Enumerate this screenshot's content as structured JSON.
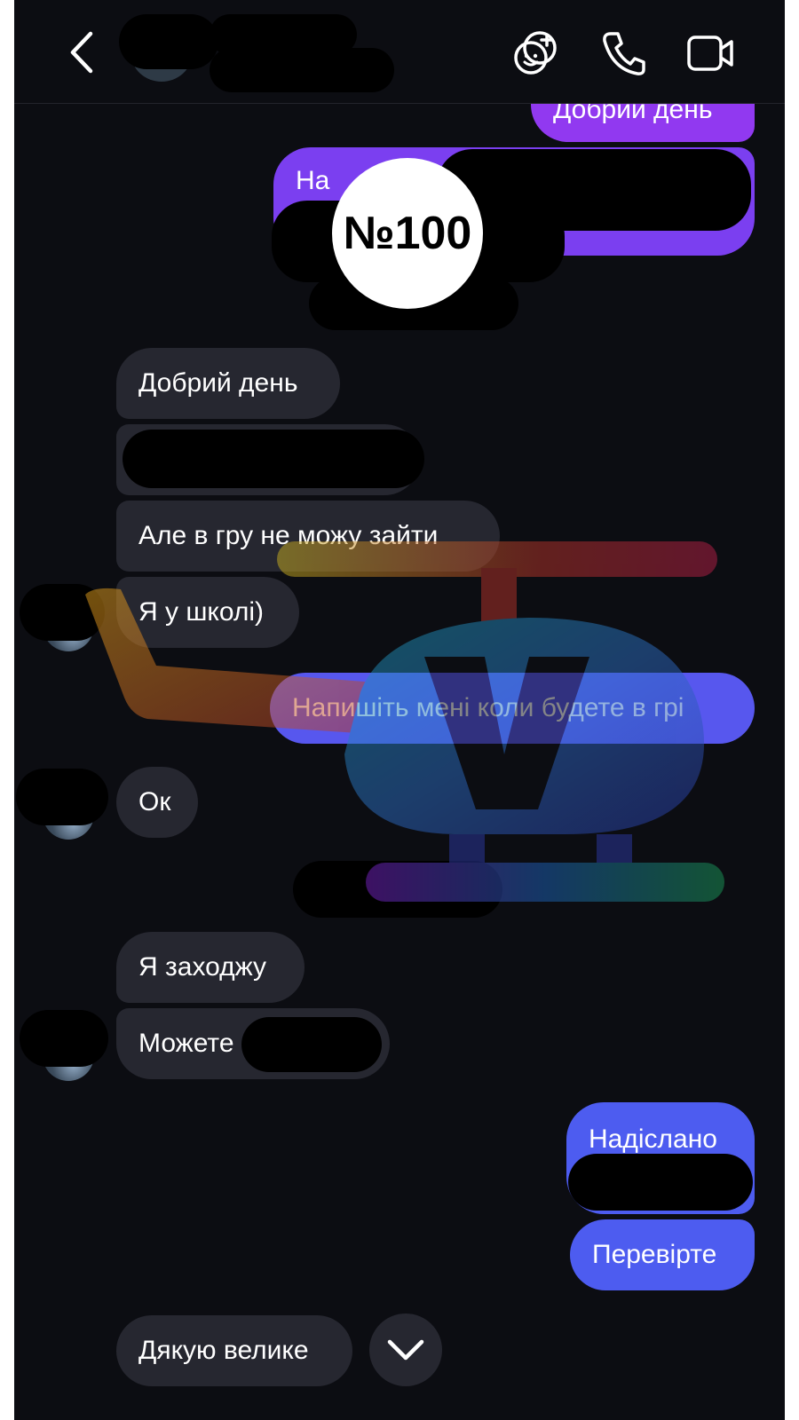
{
  "header": {
    "back_icon": "chevron-left-icon",
    "actions": [
      "effects-icon",
      "phone-icon",
      "video-camera-icon"
    ]
  },
  "outgoing": {
    "greeting": "Добрий день",
    "partial_prefix": "На",
    "request": "Напишіть мені коли будете в грі",
    "sent": "Надіслано",
    "check": "Перевірте"
  },
  "incoming": {
    "greeting": "Добрий день",
    "cant_enter": "Але в гру не можу зайти",
    "at_school": "Я у школі)",
    "ok": "Ок",
    "entering": "Я заходжу",
    "can_partial": "Можете",
    "thanks": "Дякую велике"
  },
  "badge": {
    "text": "№100"
  },
  "scroll_down": {
    "icon": "chevron-down-icon"
  },
  "watermark": {
    "letter": "V"
  },
  "colors": {
    "background": "#0c0d12",
    "incoming_bubble": "#262730",
    "outgoing_purple": "#9139f0",
    "outgoing_blue": "#4d5cf0"
  }
}
